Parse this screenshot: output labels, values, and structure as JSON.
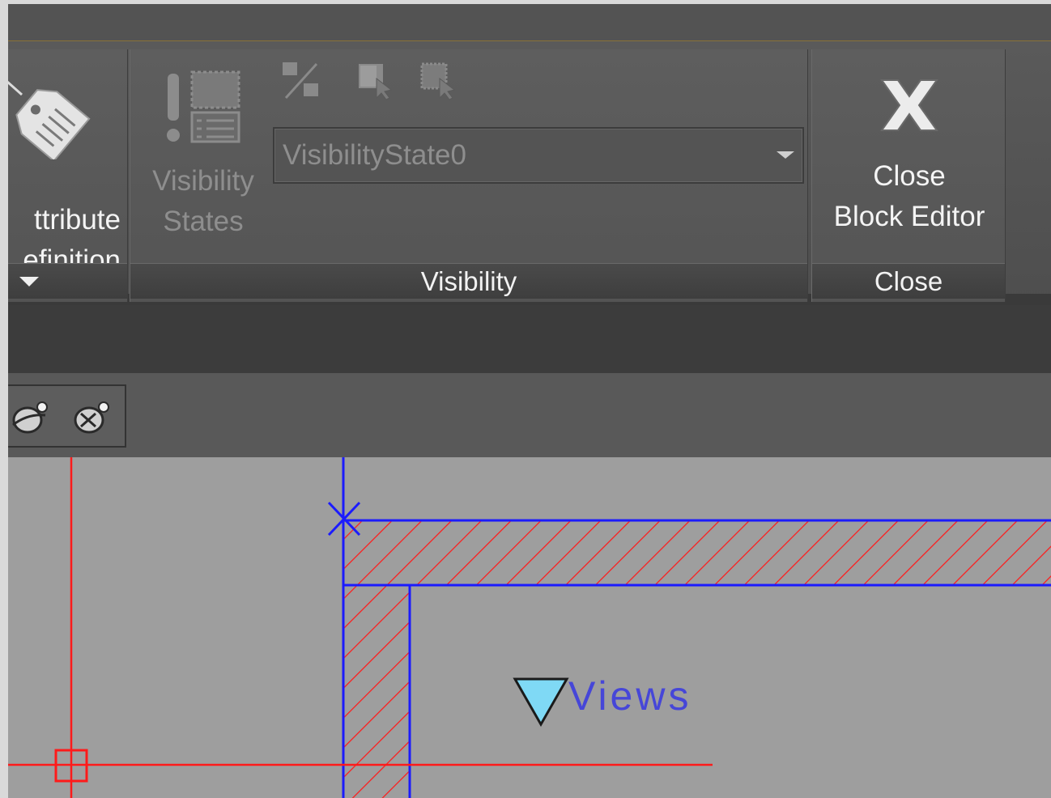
{
  "ribbon": {
    "attribute_panel": {
      "label_line1": "ttribute",
      "label_line2": "efinition"
    },
    "visibility_panel": {
      "states_label_line1": "Visibility",
      "states_label_line2": "States",
      "state_select_value": "VisibilityState0",
      "title": "Visibility"
    },
    "close_panel": {
      "button_line1": "Close",
      "button_line2": "Block Editor",
      "title": "Close"
    }
  },
  "canvas": {
    "views_label": "Views"
  },
  "colors": {
    "ribbon_bg": "#555555",
    "accent_gold": "#8a7339",
    "canvas_bg": "#9e9e9e",
    "line_blue": "#1b1bff",
    "line_red": "#ff1a1a",
    "marker_cyan": "#7fd9f5"
  }
}
